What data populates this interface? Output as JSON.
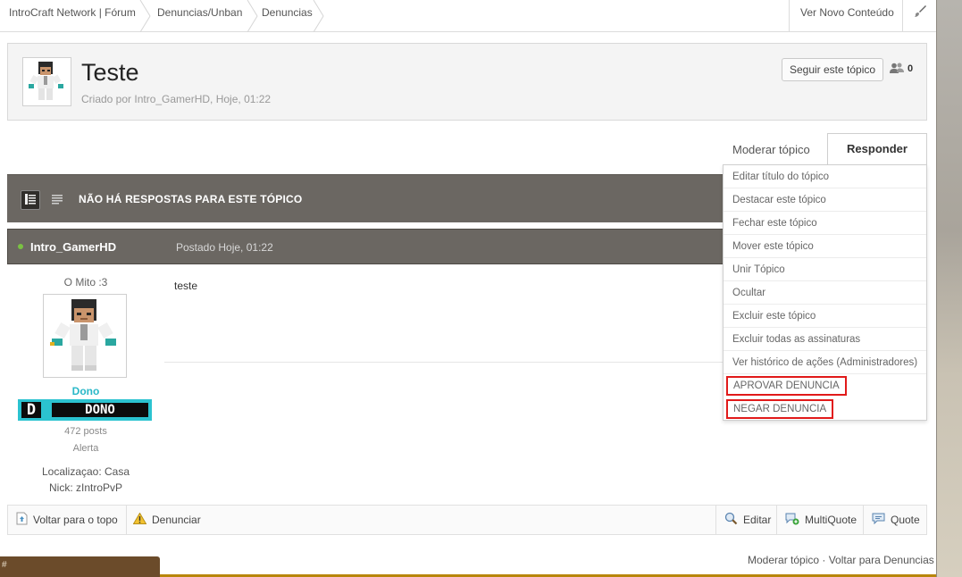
{
  "breadcrumb": [
    "IntroCraft Network | Fórum",
    "Denuncias/Unban",
    "Denuncias"
  ],
  "header_links": {
    "new_content": "Ver Novo Conteúdo"
  },
  "topic": {
    "title": "Teste",
    "meta": "Criado por Intro_GamerHD, Hoje, 01:22",
    "follow_label": "Seguir este tópico",
    "followers": "0"
  },
  "actions": {
    "moderate": "Moderar tópico",
    "reply": "Responder"
  },
  "listing": {
    "no_replies": "NÃO HÁ RESPOSTAS PARA ESTE TÓPICO"
  },
  "post": {
    "author": "Intro_GamerHD",
    "date": "Postado Hoje, 01:22",
    "body": "teste",
    "user_title": "O Mito :3",
    "rank_name": "Dono",
    "rank_badge_letter": "D",
    "rank_badge_text": "DONO",
    "post_count": "472 posts",
    "warn": "Alerta",
    "location": "Localizaçao: Casa",
    "nick": "Nick: zIntroPvP"
  },
  "mod_menu": [
    "Editar título do tópico",
    "Destacar este tópico",
    "Fechar este tópico",
    "Mover este tópico",
    "Unir Tópico",
    "Ocultar",
    "Excluir este tópico",
    "Excluir todas as assinaturas",
    "Ver histórico de ações (Administradores)",
    "APROVAR DENUNCIA",
    "NEGAR DENUNCIA"
  ],
  "controls": {
    "back_to_top": "Voltar para o topo",
    "report": "Denunciar",
    "edit": "Editar",
    "multiquote": "MultiQuote",
    "quote": "Quote"
  },
  "footer": {
    "links": "Moderar tópico · Voltar para Denuncias"
  },
  "chat_tab": "#",
  "colors": {
    "bar_dark": "#6b6762",
    "rank_cyan": "#2bc3d0",
    "flag_red": "#e11a1a",
    "online_green": "#7ac143"
  }
}
